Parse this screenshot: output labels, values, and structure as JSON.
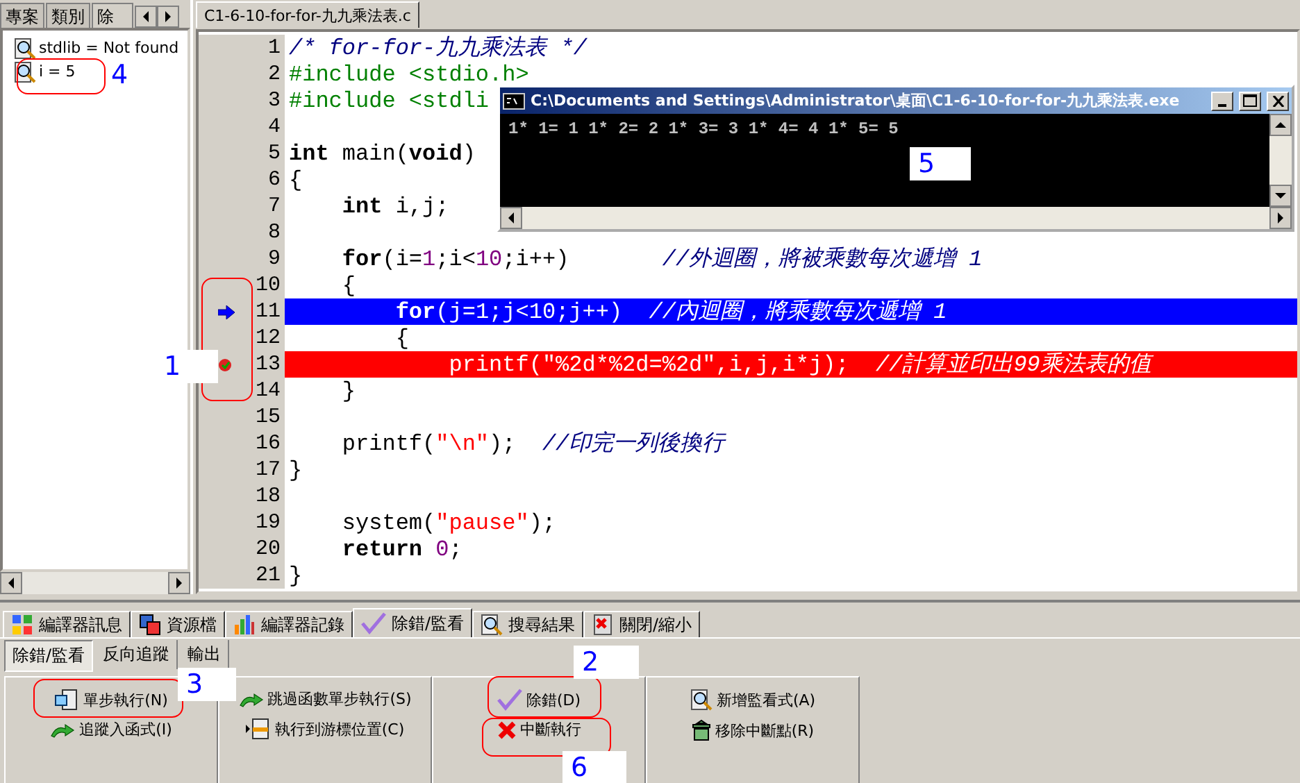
{
  "left_panel": {
    "tabs": [
      {
        "label": "專案",
        "selected": false
      },
      {
        "label": "類別",
        "selected": false
      },
      {
        "label": "除",
        "selected": true
      }
    ],
    "tree": [
      {
        "label": "stdlib = Not found"
      },
      {
        "label": "i = 5"
      }
    ]
  },
  "editor": {
    "file_tab": "C1-6-10-for-for-九九乘法表.c",
    "lines": [
      {
        "number": "1",
        "current": false,
        "breakpoint": false,
        "tokens": [
          {
            "kind": "comment",
            "text": "/* for-for-九九乘法表 */"
          }
        ]
      },
      {
        "number": "2",
        "current": false,
        "breakpoint": false,
        "tokens": [
          {
            "kind": "directive",
            "text": "#include <stdio.h>"
          }
        ]
      },
      {
        "number": "3",
        "current": false,
        "breakpoint": false,
        "tokens": [
          {
            "kind": "directive",
            "text": "#include <stdli"
          }
        ]
      },
      {
        "number": "4",
        "current": false,
        "breakpoint": false
      },
      {
        "number": "5",
        "current": false,
        "breakpoint": false,
        "tokens": [
          {
            "kind": "keyword",
            "text": "int"
          },
          {
            "kind": "plain",
            "text": " main("
          },
          {
            "kind": "keyword",
            "text": "void"
          },
          {
            "kind": "plain",
            "text": ")"
          }
        ]
      },
      {
        "number": "6",
        "current": false,
        "breakpoint": false,
        "tokens": [
          {
            "kind": "plain",
            "text": "{"
          }
        ]
      },
      {
        "number": "7",
        "current": false,
        "breakpoint": false,
        "tokens": [
          {
            "kind": "keyword",
            "text": "    int"
          },
          {
            "kind": "plain",
            "text": " i,j;"
          }
        ]
      },
      {
        "number": "8",
        "current": false,
        "breakpoint": false
      },
      {
        "number": "9",
        "current": false,
        "breakpoint": false,
        "tokens": [
          {
            "kind": "keyword",
            "text": "    for"
          },
          {
            "kind": "plain",
            "text": "(i="
          },
          {
            "kind": "number",
            "text": "1"
          },
          {
            "kind": "plain",
            "text": ";i<"
          },
          {
            "kind": "number",
            "text": "10"
          },
          {
            "kind": "plain",
            "text": ";i++)       "
          },
          {
            "kind": "comment",
            "text": "//外迴圈，將被乘數每次遞增 1"
          }
        ]
      },
      {
        "number": "10",
        "current": false,
        "breakpoint": false,
        "tokens": [
          {
            "kind": "plain",
            "text": "    {"
          }
        ]
      },
      {
        "number": "11",
        "current": true,
        "breakpoint": false,
        "tokens": [
          {
            "kind": "keyword",
            "text": "        for"
          },
          {
            "kind": "plain",
            "text": "(j="
          },
          {
            "kind": "number",
            "text": "1"
          },
          {
            "kind": "plain",
            "text": ";j<"
          },
          {
            "kind": "number",
            "text": "10"
          },
          {
            "kind": "plain",
            "text": ";j++)  "
          },
          {
            "kind": "comment",
            "text": "//內迴圈，將乘數每次遞增 1"
          }
        ]
      },
      {
        "number": "12",
        "current": false,
        "breakpoint": false,
        "tokens": [
          {
            "kind": "plain",
            "text": "        {"
          }
        ]
      },
      {
        "number": "13",
        "current": false,
        "breakpoint": true,
        "tokens": [
          {
            "kind": "plain",
            "text": "            printf("
          },
          {
            "kind": "string",
            "text": "\"%2d*%2d=%2d\""
          },
          {
            "kind": "plain",
            "text": ",i,j,i*j);  "
          },
          {
            "kind": "comment",
            "text": "//計算並印出99乘法表的值"
          }
        ]
      },
      {
        "number": "14",
        "current": false,
        "breakpoint": false,
        "tokens": [
          {
            "kind": "plain",
            "text": "    }"
          }
        ]
      },
      {
        "number": "15",
        "current": false,
        "breakpoint": false
      },
      {
        "number": "16",
        "current": false,
        "breakpoint": false,
        "tokens": [
          {
            "kind": "plain",
            "text": "    printf("
          },
          {
            "kind": "string",
            "text": "\"\\n\""
          },
          {
            "kind": "plain",
            "text": ");  "
          },
          {
            "kind": "comment",
            "text": "//印完一列後換行"
          }
        ]
      },
      {
        "number": "17",
        "current": false,
        "breakpoint": false,
        "tokens": [
          {
            "kind": "plain",
            "text": "}"
          }
        ]
      },
      {
        "number": "18",
        "current": false,
        "breakpoint": false
      },
      {
        "number": "19",
        "current": false,
        "breakpoint": false,
        "tokens": [
          {
            "kind": "plain",
            "text": "    system("
          },
          {
            "kind": "string",
            "text": "\"pause\""
          },
          {
            "kind": "plain",
            "text": ");"
          }
        ]
      },
      {
        "number": "20",
        "current": false,
        "breakpoint": false,
        "tokens": [
          {
            "kind": "keyword",
            "text": "    return"
          },
          {
            "kind": "number",
            "text": " 0"
          },
          {
            "kind": "plain",
            "text": ";"
          }
        ]
      },
      {
        "number": "21",
        "current": false,
        "breakpoint": false,
        "tokens": [
          {
            "kind": "plain",
            "text": "}"
          }
        ]
      }
    ]
  },
  "console": {
    "title": "C:\\Documents and Settings\\Administrator\\桌面\\C1-6-10-for-for-九九乘法表.exe",
    "output": "1* 1= 1 1* 2= 2 1* 3= 3 1* 4= 4 1* 5= 5"
  },
  "bottom_tabs": [
    {
      "label": "編譯器訊息",
      "selected": false
    },
    {
      "label": "資源檔",
      "selected": false
    },
    {
      "label": "編譯器記錄",
      "selected": false
    },
    {
      "label": "除錯/監看",
      "selected": true
    },
    {
      "label": "搜尋結果",
      "selected": false
    },
    {
      "label": "關閉/縮小",
      "selected": false
    }
  ],
  "sub_tabs": [
    {
      "label": "除錯/監看",
      "selected": true
    },
    {
      "label": "反向追蹤",
      "selected": false
    },
    {
      "label": "輸出",
      "selected": false
    }
  ],
  "button_groups": [
    {
      "buttons": [
        {
          "label": "單步執行(N)"
        },
        {
          "label": "追蹤入函式(I)"
        }
      ]
    },
    {
      "buttons": [
        {
          "label": "跳過函數單步執行(S)"
        },
        {
          "label": "執行到游標位置(C)"
        }
      ]
    },
    {
      "buttons": [
        {
          "label": "除錯(D)"
        },
        {
          "label": "中斷執行"
        }
      ]
    },
    {
      "buttons": [
        {
          "label": "新增監看式(A)"
        },
        {
          "label": "移除中斷點(R)"
        }
      ]
    }
  ],
  "annotations": [
    {
      "label": "1"
    },
    {
      "label": "2"
    },
    {
      "label": "3"
    },
    {
      "label": "4"
    },
    {
      "label": "5"
    },
    {
      "label": "6"
    }
  ]
}
